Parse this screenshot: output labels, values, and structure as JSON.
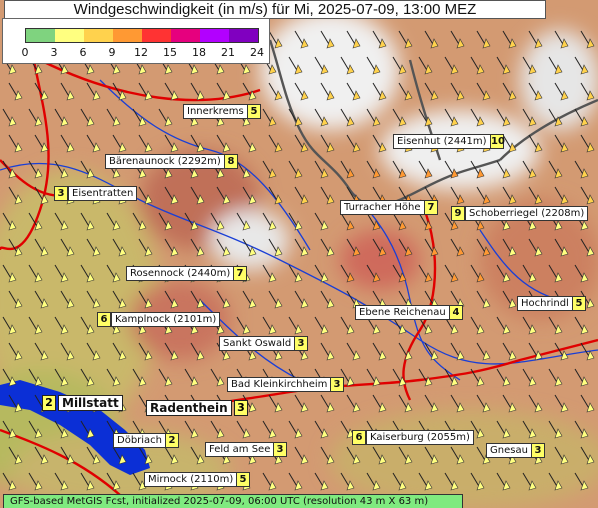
{
  "title": "Windgeschwindigkeit (in m/s) für Mi, 2025-07-09, 13:00 MEZ",
  "legend": {
    "ticks": [
      "0",
      "3",
      "6",
      "9",
      "12",
      "15",
      "18",
      "21",
      "24"
    ],
    "colors": [
      "#7fd37f",
      "#ffff80",
      "#ffd24d",
      "#ff9933",
      "#ff3333",
      "#e6007e",
      "#b200ff",
      "#8000c0"
    ]
  },
  "footer": "GFS-based MetGIS Fcst, initialized 2025-07-09, 06:00 UTC  (resolution 43 m X 63 m)",
  "places": [
    {
      "name": "Innerkrems",
      "value": "5"
    },
    {
      "name": "Bärenaunock (2292m)",
      "value": "8"
    },
    {
      "name": "Eisentratten",
      "value": "3"
    },
    {
      "name": "Eisenhut (2441m)",
      "value": "10"
    },
    {
      "name": "Turracher Höhe",
      "value": "7"
    },
    {
      "name": "Schoberriegel (2208m)",
      "value": "9"
    },
    {
      "name": "Rosennock (2440m)",
      "value": "7"
    },
    {
      "name": "Kamplnock (2101m)",
      "value": "6"
    },
    {
      "name": "Ebene Reichenau",
      "value": "4"
    },
    {
      "name": "Hochrindl",
      "value": "5"
    },
    {
      "name": "Sankt Oswald",
      "value": "3"
    },
    {
      "name": "Bad Kleinkirchheim",
      "value": "3"
    },
    {
      "name": "Döbriach",
      "value": "2"
    },
    {
      "name": "Feld am See",
      "value": "3"
    },
    {
      "name": "Kaiserburg (2055m)",
      "value": "6"
    },
    {
      "name": "Gnesau",
      "value": "3"
    },
    {
      "name": "Mirnock (2110m)",
      "value": "5"
    }
  ],
  "towns": [
    {
      "name": "Millstatt",
      "value": "2"
    },
    {
      "name": "Radenthein",
      "value": "3"
    }
  ]
}
